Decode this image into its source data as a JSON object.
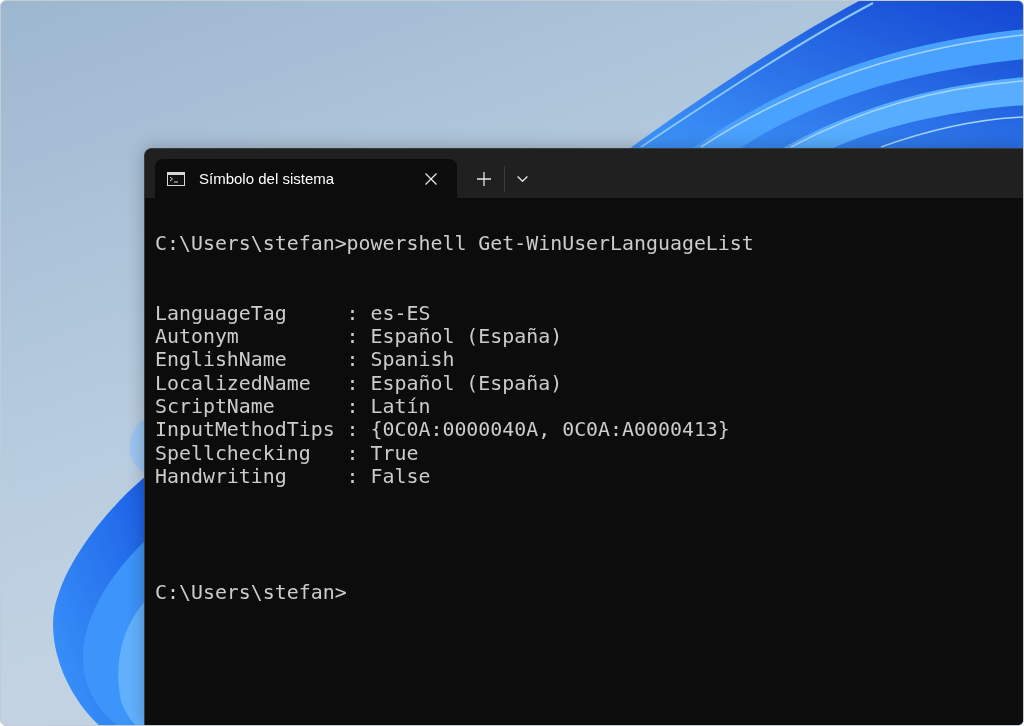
{
  "window": {
    "tabs": [
      {
        "title": "Símbolo del sistema",
        "selected": true
      }
    ]
  },
  "terminal": {
    "blocks": [
      {
        "kind": "command",
        "lines": [
          "C:\\Users\\stefan>powershell Get-WinUserLanguageList"
        ]
      },
      {
        "kind": "output",
        "lines": [
          "LanguageTag     : es-ES",
          "Autonym         : Español (España)",
          "EnglishName     : Spanish",
          "LocalizedName   : Español (España)",
          "ScriptName      : Latín",
          "InputMethodTips : {0C0A:0000040A, 0C0A:A0000413}",
          "Spellchecking   : True",
          "Handwriting     : False"
        ]
      },
      {
        "kind": "prompt",
        "lines": [
          "C:\\Users\\stefan>"
        ]
      }
    ]
  }
}
